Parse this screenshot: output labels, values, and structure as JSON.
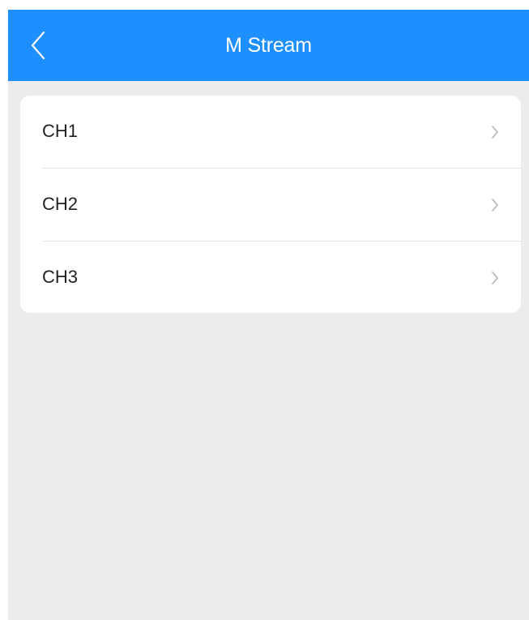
{
  "header": {
    "title": "M Stream",
    "back_icon": "chevron-left-icon",
    "background_color": "#1e8fff"
  },
  "channels": [
    {
      "label": "CH1",
      "icon": "chevron-right-icon"
    },
    {
      "label": "CH2",
      "icon": "chevron-right-icon"
    },
    {
      "label": "CH3",
      "icon": "chevron-right-icon"
    }
  ]
}
